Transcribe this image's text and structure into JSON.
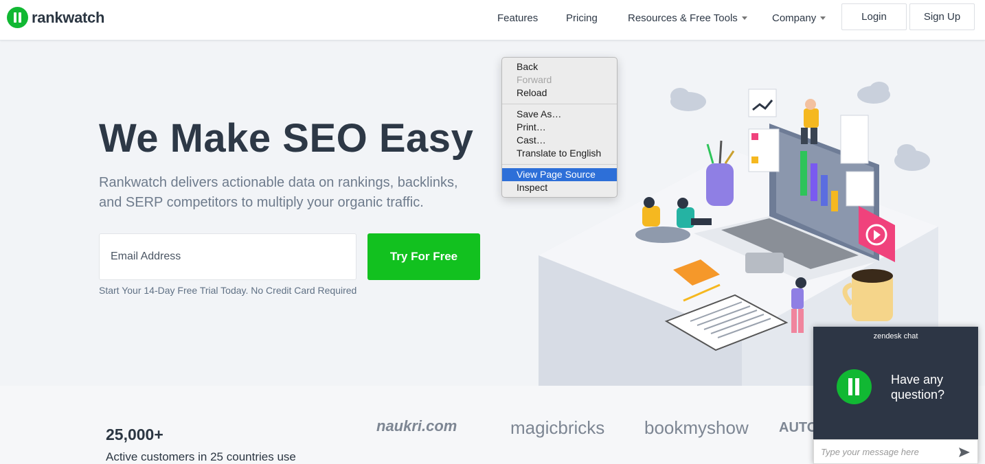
{
  "header": {
    "logo_text": "rankwatch",
    "nav": {
      "features": "Features",
      "pricing": "Pricing",
      "resources": "Resources & Free Tools",
      "company": "Company"
    },
    "login": "Login",
    "signup": "Sign Up"
  },
  "hero": {
    "title": "We Make SEO Easy",
    "subtitle": "Rankwatch delivers actionable data on rankings, backlinks, and SERP competitors to multiply your organic traffic.",
    "email_placeholder": "Email Address",
    "cta": "Try For Free",
    "trial_note": "Start Your 14-Day Free Trial Today. No Credit Card Required"
  },
  "customers": {
    "count": "25,000+",
    "text": "Active customers in 25 countries use",
    "logos": [
      "naukri.com",
      "magicbricks",
      "bookmyshow",
      "AUTO"
    ]
  },
  "context_menu": {
    "items": [
      {
        "label": "Back",
        "disabled": false
      },
      {
        "label": "Forward",
        "disabled": true
      },
      {
        "label": "Reload",
        "disabled": false
      },
      {
        "label": "Save As…",
        "disabled": false
      },
      {
        "label": "Print…",
        "disabled": false
      },
      {
        "label": "Cast…",
        "disabled": false
      },
      {
        "label": "Translate to English",
        "disabled": false
      },
      {
        "label": "View Page Source",
        "disabled": false,
        "selected": true
      },
      {
        "label": "Inspect",
        "disabled": false
      }
    ]
  },
  "chat": {
    "header": "zendesk chat",
    "question": "Have any question?",
    "input_placeholder": "Type your message here"
  },
  "colors": {
    "brand_green": "#11b833",
    "cta_green": "#12c11f",
    "text_dark": "#2d3846",
    "menu_highlight": "#2d6fd8",
    "chat_bg": "#2d3645"
  }
}
